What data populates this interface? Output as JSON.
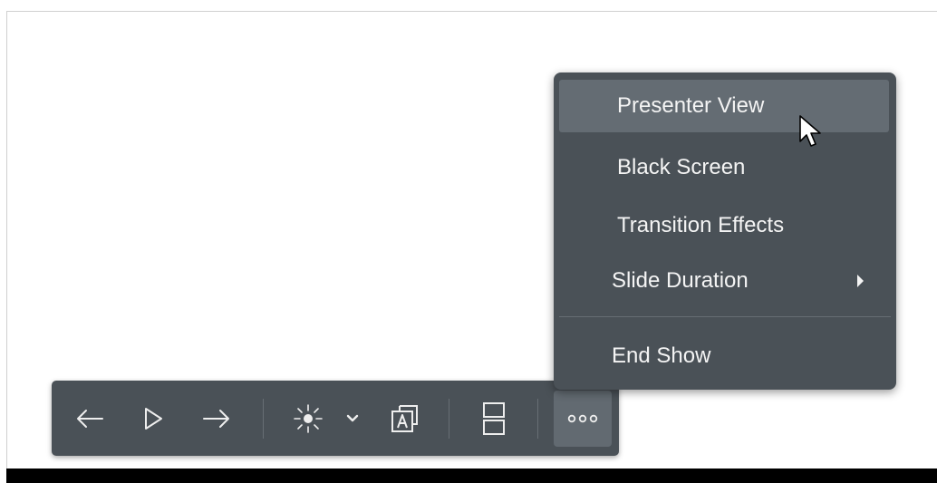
{
  "menu": {
    "items": [
      {
        "label": "Presenter View",
        "state": "hover"
      },
      {
        "label": "Black Screen"
      },
      {
        "label": "Transition Effects"
      },
      {
        "label": "Slide Duration",
        "has_submenu": true
      },
      {
        "label": "End Show"
      }
    ]
  },
  "toolbar": {
    "buttons": [
      {
        "icon": "arrow-left-icon"
      },
      {
        "icon": "play-icon"
      },
      {
        "icon": "arrow-right-icon"
      },
      {
        "icon": "laser-pointer-icon"
      },
      {
        "icon": "chevron-down-icon"
      },
      {
        "icon": "subtitles-icon"
      },
      {
        "icon": "layout-icon"
      },
      {
        "icon": "more-options-icon",
        "state": "active"
      }
    ]
  },
  "colors": {
    "toolbar_bg": "#4a5157",
    "menu_bg": "#4a5157",
    "hover_bg": "#646c73",
    "text": "#f4f4f4"
  }
}
